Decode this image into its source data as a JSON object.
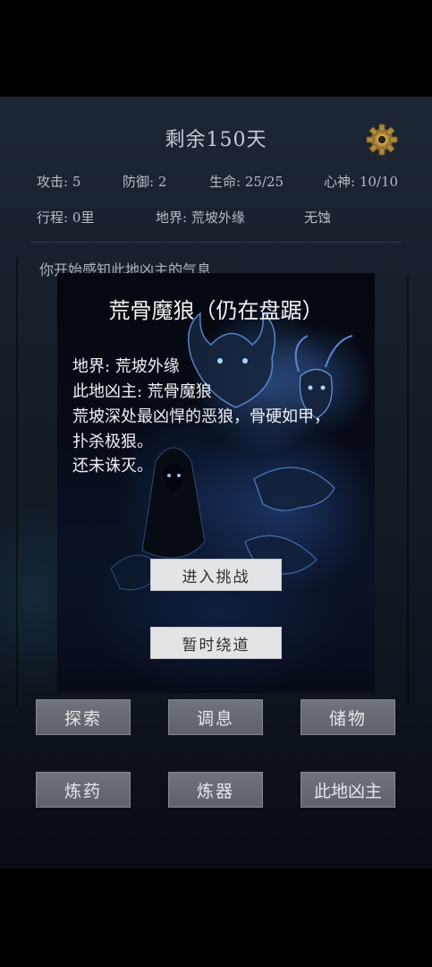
{
  "header": {
    "days_remaining": "剩余150天",
    "settings_icon": "gear-icon"
  },
  "stats": {
    "attack": "攻击: 5",
    "defense": "防御: 2",
    "life": "生命: 25/25",
    "mind": "心神: 10/10",
    "journey": "行程: 0里",
    "realm": "地界: 荒坡外缘",
    "corruption": "无蚀"
  },
  "log": {
    "line1": "你开始感知此地凶主的气息"
  },
  "modal": {
    "title": "荒骨魔狼（仍在盘踞）",
    "line1": "地界: 荒坡外缘",
    "line2": "此地凶主: 荒骨魔狼",
    "line3": "荒坡深处最凶悍的恶狼，骨硬如甲，",
    "line4": "扑杀极狠。",
    "line5": "还未诛灭。",
    "challenge_label": "进入挑战",
    "detour_label": "暂时绕道"
  },
  "actions": {
    "explore": "探索",
    "rest": "调息",
    "storage": "储物",
    "alchemy": "炼药",
    "forge": "炼器",
    "boss": "此地凶主"
  },
  "colors": {
    "background": "#000000",
    "panel": "#18202c",
    "button": "#666a72",
    "modal_button": "#e3e4e6",
    "monster_glow": "#4a7bd0"
  }
}
